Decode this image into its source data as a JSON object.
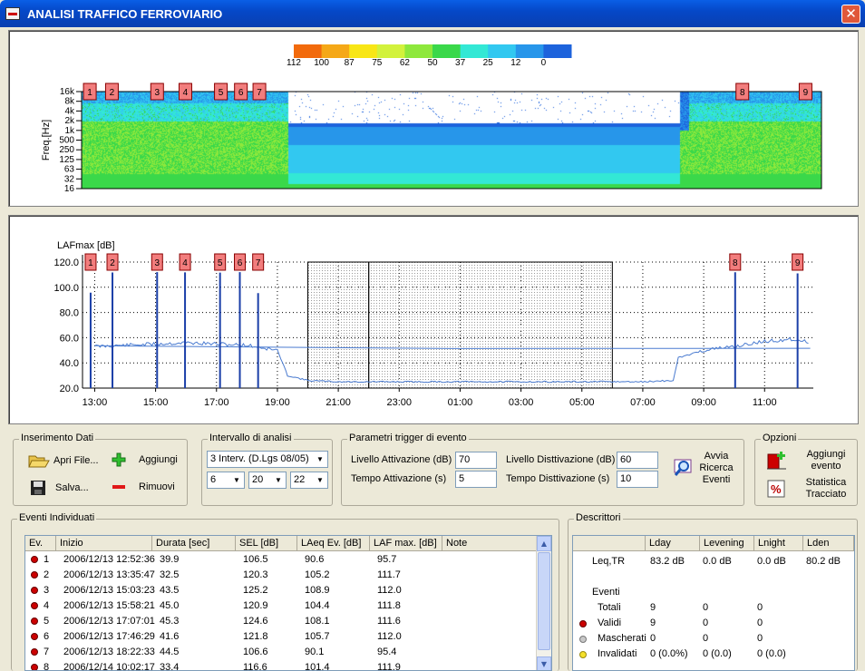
{
  "window": {
    "title": "ANALISI TRAFFICO FERROVIARIO",
    "close": "✕"
  },
  "colors": {
    "titlebar": "#0a5fe6",
    "marker": "#f27d7d",
    "series": "#4a7bd0"
  },
  "scale": {
    "labels": [
      "112",
      "100",
      "87",
      "75",
      "62",
      "50",
      "37",
      "25",
      "12",
      "0"
    ],
    "colors": [
      "#f26a0c",
      "#f5a817",
      "#f8e616",
      "#d2f23c",
      "#8ee83c",
      "#3ad84a",
      "#33e8d5",
      "#32c8f0",
      "#2796ea",
      "#1d63dc"
    ]
  },
  "spectrogram": {
    "ylabel": "Freq.[Hz]",
    "yticks": [
      "16k",
      "8k",
      "4k",
      "2k",
      "1k",
      "500",
      "250",
      "125",
      "63",
      "32",
      "16"
    ]
  },
  "markers": [
    "1",
    "2",
    "3",
    "4",
    "5",
    "6",
    "7",
    "8",
    "9"
  ],
  "chart_data": {
    "type": "line",
    "title": "",
    "ylabel": "LAFmax [dB]",
    "xlabel": "",
    "ylim": [
      20,
      120
    ],
    "yticks": [
      "120.0",
      "100.0",
      "80.0",
      "60.0",
      "40.0",
      "20.0"
    ],
    "xticks": [
      "13:00",
      "15:00",
      "17:00",
      "19:00",
      "21:00",
      "23:00",
      "01:00",
      "03:00",
      "05:00",
      "07:00",
      "09:00",
      "11:00"
    ],
    "xlim_hours": [
      12.6,
      12.6
    ],
    "series": [
      {
        "x": [
          "12:30",
          "13:00",
          "14:00",
          "15:00",
          "16:00",
          "17:00",
          "18:00",
          "19:00",
          "19:20",
          "20:00",
          "21:00",
          "23:00",
          "01:00",
          "03:00",
          "05:00",
          "07:00",
          "08:00",
          "08:10",
          "09:00",
          "10:00",
          "11:00",
          "12:00",
          "12:30"
        ],
        "values": [
          52,
          53,
          54,
          55,
          56,
          55,
          54,
          50,
          30,
          26,
          25,
          25,
          25,
          25,
          25,
          25,
          26,
          44,
          50,
          53,
          57,
          59,
          56
        ]
      }
    ],
    "event_peaks": [
      {
        "label": "1",
        "time": "12:52",
        "value": 95.7
      },
      {
        "label": "2",
        "time": "13:35",
        "value": 111.7
      },
      {
        "label": "3",
        "time": "15:03",
        "value": 112.0
      },
      {
        "label": "4",
        "time": "15:58",
        "value": 111.8
      },
      {
        "label": "5",
        "time": "17:07",
        "value": 111.6
      },
      {
        "label": "6",
        "time": "17:46",
        "value": 112.0
      },
      {
        "label": "7",
        "time": "18:22",
        "value": 95.4
      },
      {
        "label": "8",
        "time": "10:02",
        "value": 111.9
      },
      {
        "label": "9",
        "time": "12:05",
        "value": 111.0
      }
    ],
    "intervals": [
      {
        "start": "20:00",
        "end": "22:00"
      },
      {
        "start": "22:00",
        "end": "06:00"
      }
    ]
  },
  "inserimento": {
    "legend": "Inserimento Dati",
    "open": "Apri File...",
    "save": "Salva...",
    "add": "Aggiungi",
    "remove": "Rimuovi"
  },
  "intervallo": {
    "legend": "Intervallo di analisi",
    "mode": "3 Interv. (D.Lgs 08/05)",
    "v1": "6",
    "v2": "20",
    "v3": "22"
  },
  "trigger": {
    "legend": "Parametri trigger di evento",
    "att_level_label": "Livello Attivazione (dB)",
    "att_level": "70",
    "att_time_label": "Tempo Attivazione (s)",
    "att_time": "5",
    "deatt_level_label": "Livello Disttivazione (dB)",
    "deatt_level": "60",
    "deatt_time_label": "Tempo Disttivazione (s)",
    "deatt_time": "10",
    "search": [
      "Avvia",
      "Ricerca",
      "Eventi"
    ]
  },
  "opzioni": {
    "legend": "Opzioni",
    "add_event": [
      "Aggiungi",
      "evento"
    ],
    "stats": [
      "Statistica",
      "Tracciato"
    ]
  },
  "eventi": {
    "legend": "Eventi Individuati",
    "columns": [
      "Ev.",
      "Inizio",
      "Durata [sec]",
      "SEL [dB]",
      "LAeq Ev. [dB]",
      "LAF max. [dB]",
      "Note"
    ],
    "rows": [
      [
        "1",
        "2006/12/13 12:52:36",
        "39.9",
        "106.5",
        "90.6",
        "95.7",
        ""
      ],
      [
        "2",
        "2006/12/13 13:35:47",
        "32.5",
        "120.3",
        "105.2",
        "111.7",
        ""
      ],
      [
        "3",
        "2006/12/13 15:03:23",
        "43.5",
        "125.2",
        "108.9",
        "112.0",
        ""
      ],
      [
        "4",
        "2006/12/13 15:58:21",
        "45.0",
        "120.9",
        "104.4",
        "111.8",
        ""
      ],
      [
        "5",
        "2006/12/13 17:07:01",
        "45.3",
        "124.6",
        "108.1",
        "111.6",
        ""
      ],
      [
        "6",
        "2006/12/13 17:46:29",
        "41.6",
        "121.8",
        "105.7",
        "112.0",
        ""
      ],
      [
        "7",
        "2006/12/13 18:22:33",
        "44.5",
        "106.6",
        "90.1",
        "95.4",
        ""
      ],
      [
        "8",
        "2006/12/14 10:02:17",
        "33.4",
        "116.6",
        "101.4",
        "111.9",
        ""
      ]
    ]
  },
  "descrittori": {
    "legend": "Descrittori",
    "columns": [
      "",
      "Lday",
      "Levening",
      "Lnight",
      "Lden"
    ],
    "leq_label": "Leq,TR",
    "leq": [
      "83.2 dB",
      "0.0 dB",
      "0.0 dB",
      "80.2 dB"
    ],
    "eventi_label": "Eventi",
    "totali_label": "Totali",
    "totali": [
      "9",
      "0",
      "0"
    ],
    "validi_label": "Validi",
    "validi": [
      "9",
      "0",
      "0"
    ],
    "mascherati_label": "Mascherati",
    "mascherati": [
      "0",
      "0",
      "0"
    ],
    "invalidati_label": "Invalidati",
    "invalidati": [
      "0 (0.0%)",
      "0 (0.0)",
      "0 (0.0)"
    ]
  }
}
